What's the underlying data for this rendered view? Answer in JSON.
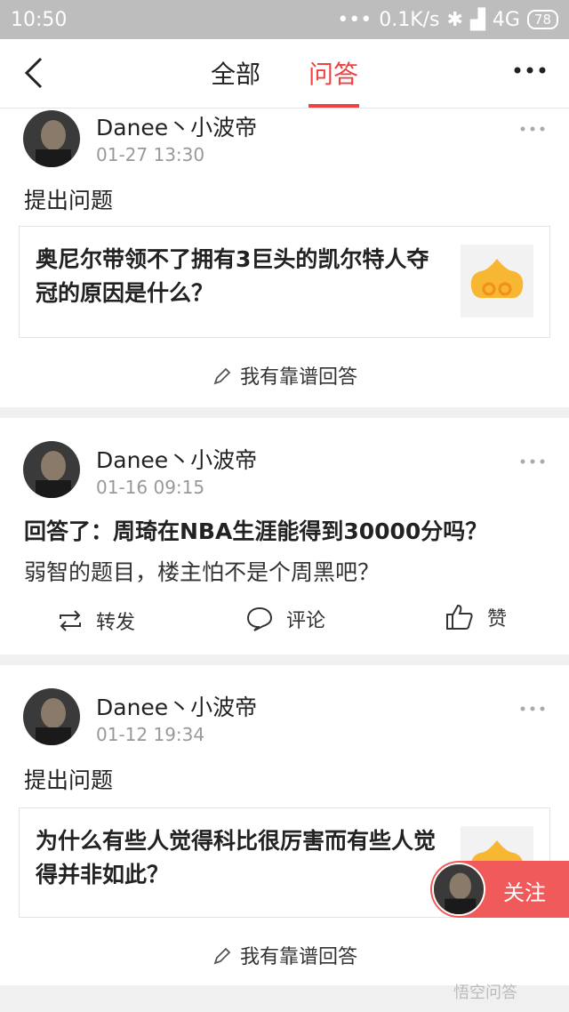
{
  "status": {
    "time": "10:50",
    "speed": "0.1K/s",
    "network": "4G",
    "battery": "78"
  },
  "nav": {
    "tab_all": "全部",
    "tab_qa": "问答"
  },
  "posts": [
    {
      "user": "Danee丶小波帝",
      "time": "01-27 13:30",
      "action": "提出问题",
      "question": "奥尼尔带领不了拥有3巨头的凯尔特人夺冠的原因是什么？",
      "answer_btn": "我有靠谱回答"
    },
    {
      "user": "Danee丶小波帝",
      "time": "01-16 09:15",
      "title": "回答了：周琦在NBA生涯能得到30000分吗？",
      "body": "弱智的题目，楼主怕不是个周黑吧？",
      "forward": "转发",
      "comment": "评论",
      "like": "赞"
    },
    {
      "user": "Danee丶小波帝",
      "time": "01-12 19:34",
      "action": "提出问题",
      "question": "为什么有些人觉得科比很厉害而有些人觉得并非如此？",
      "answer_btn": "我有靠谱回答"
    }
  ],
  "follow": {
    "label": "关注"
  },
  "watermark": "悟空问答",
  "colors": {
    "accent": "#f04142",
    "follow_bg": "#f05a5a",
    "separator": "#f0f0f0"
  }
}
